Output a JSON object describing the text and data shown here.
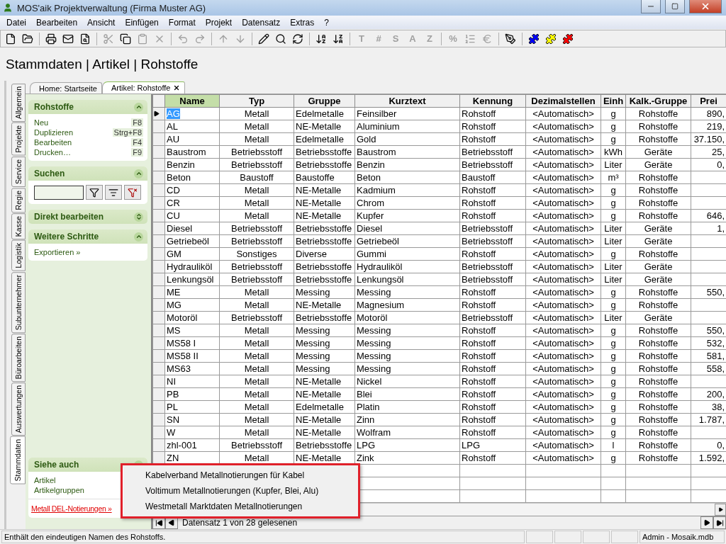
{
  "window": {
    "title": "MOS'aik Projektverwaltung (Firma Muster AG)"
  },
  "menu": [
    "Datei",
    "Bearbeiten",
    "Ansicht",
    "Einfügen",
    "Format",
    "Projekt",
    "Datensatz",
    "Extras",
    "?"
  ],
  "toolbar": [
    {
      "kind": "new",
      "disabled": false
    },
    {
      "kind": "open",
      "disabled": false
    },
    {
      "kind": "separator"
    },
    {
      "kind": "print",
      "disabled": false
    },
    {
      "kind": "send",
      "disabled": false
    },
    {
      "kind": "preview",
      "disabled": false
    },
    {
      "kind": "separator"
    },
    {
      "kind": "cut",
      "disabled": true
    },
    {
      "kind": "copy",
      "disabled": false
    },
    {
      "kind": "paste",
      "disabled": true
    },
    {
      "kind": "delete",
      "disabled": true
    },
    {
      "kind": "separator"
    },
    {
      "kind": "undo",
      "disabled": true
    },
    {
      "kind": "redo",
      "disabled": true
    },
    {
      "kind": "separator"
    },
    {
      "kind": "up",
      "disabled": true
    },
    {
      "kind": "down",
      "disabled": true
    },
    {
      "kind": "separator"
    },
    {
      "kind": "edit",
      "disabled": false
    },
    {
      "kind": "find",
      "disabled": false
    },
    {
      "kind": "refresh",
      "disabled": false
    },
    {
      "kind": "separator"
    },
    {
      "kind": "sort-asc",
      "disabled": false
    },
    {
      "kind": "sort-desc",
      "disabled": false
    },
    {
      "kind": "separator"
    },
    {
      "kind": "glyph",
      "label": "T",
      "disabled": true
    },
    {
      "kind": "glyph",
      "label": "#",
      "disabled": true
    },
    {
      "kind": "glyph",
      "label": "S",
      "disabled": true
    },
    {
      "kind": "glyph",
      "label": "A",
      "disabled": true
    },
    {
      "kind": "glyph",
      "label": "Z",
      "disabled": true
    },
    {
      "kind": "separator"
    },
    {
      "kind": "glyph",
      "label": "%",
      "disabled": true
    },
    {
      "kind": "numbering",
      "disabled": true
    },
    {
      "kind": "currency",
      "disabled": true
    },
    {
      "kind": "separator"
    },
    {
      "kind": "tool",
      "disabled": false
    },
    {
      "kind": "separator"
    },
    {
      "kind": "puzzle",
      "color": "#0000ff",
      "disabled": false
    },
    {
      "kind": "puzzle",
      "color": "#ffff00",
      "disabled": false
    },
    {
      "kind": "puzzle",
      "color": "#ff0000",
      "disabled": false
    }
  ],
  "breadcrumb": "Stammdaten | Artikel | Rohstoffe",
  "side_tabs": [
    {
      "label": "Allgemein",
      "selected": false
    },
    {
      "label": "Projekte",
      "selected": false
    },
    {
      "label": "Service",
      "selected": false
    },
    {
      "label": "Regie",
      "selected": false
    },
    {
      "label": "Kasse",
      "selected": false
    },
    {
      "label": "Logistik",
      "selected": false
    },
    {
      "label": "Subunternehmer",
      "selected": false
    },
    {
      "label": "Büroarbeiten",
      "selected": false
    },
    {
      "label": "Auswertungen",
      "selected": false
    },
    {
      "label": "Stammdaten",
      "selected": true
    }
  ],
  "doc_tabs": [
    {
      "label": "Home: Startseite",
      "selected": false,
      "closable": false
    },
    {
      "label": "Artikel: Rohstoffe",
      "selected": true,
      "closable": true
    }
  ],
  "task_panel": {
    "groups": [
      {
        "kind": "actions",
        "title": "Rohstoffe",
        "expanded": true,
        "items": [
          {
            "label": "Neu",
            "shortcut": "F8"
          },
          {
            "label": "Duplizieren",
            "shortcut": "Strg+F8"
          },
          {
            "label": "Bearbeiten",
            "shortcut": "F4"
          },
          {
            "label": "Drucken…",
            "shortcut": "F9"
          }
        ]
      },
      {
        "kind": "search",
        "title": "Suchen",
        "expanded": true
      },
      {
        "kind": "actions",
        "title": "Direkt bearbeiten",
        "expanded": false
      },
      {
        "kind": "actions",
        "title": "Weitere Schritte",
        "expanded": true,
        "items": [
          {
            "label": "Exportieren »"
          }
        ]
      },
      {
        "kind": "spacer"
      },
      {
        "kind": "links",
        "title": "Siehe auch",
        "expanded": true,
        "items": [
          {
            "label": "Artikel"
          },
          {
            "label": "Artikelgruppen"
          }
        ],
        "link": "Metall DEL-Notierungen »"
      }
    ]
  },
  "table": {
    "columns": [
      "Name",
      "Typ",
      "Gruppe",
      "Kurztext",
      "Kennung",
      "Dezimalstellen",
      "Einh",
      "Kalk.-Gruppe",
      "Prei"
    ],
    "rows": [
      {
        "selected": true,
        "cells": [
          "AG",
          "Metall",
          "Edelmetalle",
          "Feinsilber",
          "Rohstoff",
          "<Automatisch>",
          "g",
          "Rohstoffe",
          "890,"
        ]
      },
      {
        "selected": false,
        "cells": [
          "AL",
          "Metall",
          "NE-Metalle",
          "Aluminium",
          "Rohstoff",
          "<Automatisch>",
          "g",
          "Rohstoffe",
          "219,"
        ]
      },
      {
        "selected": false,
        "cells": [
          "AU",
          "Metall",
          "Edelmetalle",
          "Gold",
          "Rohstoff",
          "<Automatisch>",
          "g",
          "Rohstoffe",
          "37.150,"
        ]
      },
      {
        "selected": false,
        "cells": [
          "Baustrom",
          "Betriebsstoff",
          "Betriebsstoffe",
          "Baustrom",
          "Betriebsstoff",
          "<Automatisch>",
          "kWh",
          "Geräte",
          "25,"
        ]
      },
      {
        "selected": false,
        "cells": [
          "Benzin",
          "Betriebsstoff",
          "Betriebsstoffe",
          "Benzin",
          "Betriebsstoff",
          "<Automatisch>",
          "Liter",
          "Geräte",
          "0,"
        ]
      },
      {
        "selected": false,
        "cells": [
          "Beton",
          "Baustoff",
          "Baustoffe",
          "Beton",
          "Baustoff",
          "<Automatisch>",
          "m³",
          "Rohstoffe",
          ""
        ]
      },
      {
        "selected": false,
        "cells": [
          "CD",
          "Metall",
          "NE-Metalle",
          "Kadmium",
          "Rohstoff",
          "<Automatisch>",
          "g",
          "Rohstoffe",
          ""
        ]
      },
      {
        "selected": false,
        "cells": [
          "CR",
          "Metall",
          "NE-Metalle",
          "Chrom",
          "Rohstoff",
          "<Automatisch>",
          "g",
          "Rohstoffe",
          ""
        ]
      },
      {
        "selected": false,
        "cells": [
          "CU",
          "Metall",
          "NE-Metalle",
          "Kupfer",
          "Rohstoff",
          "<Automatisch>",
          "g",
          "Rohstoffe",
          "646,"
        ]
      },
      {
        "selected": false,
        "cells": [
          "Diesel",
          "Betriebsstoff",
          "Betriebsstoffe",
          "Diesel",
          "Betriebsstoff",
          "<Automatisch>",
          "Liter",
          "Geräte",
          "1,"
        ]
      },
      {
        "selected": false,
        "cells": [
          "Getriebeöl",
          "Betriebsstoff",
          "Betriebsstoffe",
          "Getriebeöl",
          "Betriebsstoff",
          "<Automatisch>",
          "Liter",
          "Geräte",
          ""
        ]
      },
      {
        "selected": false,
        "cells": [
          "GM",
          "Sonstiges",
          "Diverse",
          "Gummi",
          "Rohstoff",
          "<Automatisch>",
          "g",
          "Rohstoffe",
          ""
        ]
      },
      {
        "selected": false,
        "cells": [
          "Hydrauliköl",
          "Betriebsstoff",
          "Betriebsstoffe",
          "Hydrauliköl",
          "Betriebsstoff",
          "<Automatisch>",
          "Liter",
          "Geräte",
          ""
        ]
      },
      {
        "selected": false,
        "cells": [
          "Lenkungsöl",
          "Betriebsstoff",
          "Betriebsstoffe",
          "Lenkungsöl",
          "Betriebsstoff",
          "<Automatisch>",
          "Liter",
          "Geräte",
          ""
        ]
      },
      {
        "selected": false,
        "cells": [
          "ME",
          "Metall",
          "Messing",
          "Messing",
          "Rohstoff",
          "<Automatisch>",
          "g",
          "Rohstoffe",
          "550,"
        ]
      },
      {
        "selected": false,
        "cells": [
          "MG",
          "Metall",
          "NE-Metalle",
          "Magnesium",
          "Rohstoff",
          "<Automatisch>",
          "g",
          "Rohstoffe",
          ""
        ]
      },
      {
        "selected": false,
        "cells": [
          "Motoröl",
          "Betriebsstoff",
          "Betriebsstoffe",
          "Motoröl",
          "Betriebsstoff",
          "<Automatisch>",
          "Liter",
          "Geräte",
          ""
        ]
      },
      {
        "selected": false,
        "cells": [
          "MS",
          "Metall",
          "Messing",
          "Messing",
          "Rohstoff",
          "<Automatisch>",
          "g",
          "Rohstoffe",
          "550,"
        ]
      },
      {
        "selected": false,
        "cells": [
          "MS58 I",
          "Metall",
          "Messing",
          "Messing",
          "Rohstoff",
          "<Automatisch>",
          "g",
          "Rohstoffe",
          "532,"
        ]
      },
      {
        "selected": false,
        "cells": [
          "MS58 II",
          "Metall",
          "Messing",
          "Messing",
          "Rohstoff",
          "<Automatisch>",
          "g",
          "Rohstoffe",
          "581,"
        ]
      },
      {
        "selected": false,
        "cells": [
          "MS63",
          "Metall",
          "Messing",
          "Messing",
          "Rohstoff",
          "<Automatisch>",
          "g",
          "Rohstoffe",
          "558,"
        ]
      },
      {
        "selected": false,
        "cells": [
          "NI",
          "Metall",
          "NE-Metalle",
          "Nickel",
          "Rohstoff",
          "<Automatisch>",
          "g",
          "Rohstoffe",
          ""
        ]
      },
      {
        "selected": false,
        "cells": [
          "PB",
          "Metall",
          "NE-Metalle",
          "Blei",
          "Rohstoff",
          "<Automatisch>",
          "g",
          "Rohstoffe",
          "200,"
        ]
      },
      {
        "selected": false,
        "cells": [
          "PL",
          "Metall",
          "Edelmetalle",
          "Platin",
          "Rohstoff",
          "<Automatisch>",
          "g",
          "Rohstoffe",
          "38,"
        ]
      },
      {
        "selected": false,
        "cells": [
          "SN",
          "Metall",
          "NE-Metalle",
          "Zinn",
          "Rohstoff",
          "<Automatisch>",
          "g",
          "Rohstoffe",
          "1.787,"
        ]
      },
      {
        "selected": false,
        "cells": [
          "W",
          "Metall",
          "NE-Metalle",
          "Wolfram",
          "Rohstoff",
          "<Automatisch>",
          "g",
          "Rohstoffe",
          ""
        ]
      },
      {
        "selected": false,
        "cells": [
          "zhl-001",
          "Betriebsstoff",
          "Betriebsstoffe",
          "LPG",
          "LPG",
          "<Automatisch>",
          "l",
          "Rohstoffe",
          "0,"
        ]
      },
      {
        "selected": false,
        "cells": [
          "ZN",
          "Metall",
          "NE-Metalle",
          "Zink",
          "Rohstoff",
          "<Automatisch>",
          "g",
          "Rohstoffe",
          "1.592,"
        ]
      }
    ]
  },
  "navigator": {
    "text": "Datensatz 1 von 28 gelesenen"
  },
  "context_menu": [
    "Kabelverband Metallnotierungen für Kabel",
    "Voltimum Metallnotierungen (Kupfer, Blei, Alu)",
    "Westmetall Marktdaten Metallnotierungen"
  ],
  "status_bar": {
    "message": "Enthält den eindeutigen Namen des Rohstoffs.",
    "user": "Admin - Mosaik.mdb"
  }
}
